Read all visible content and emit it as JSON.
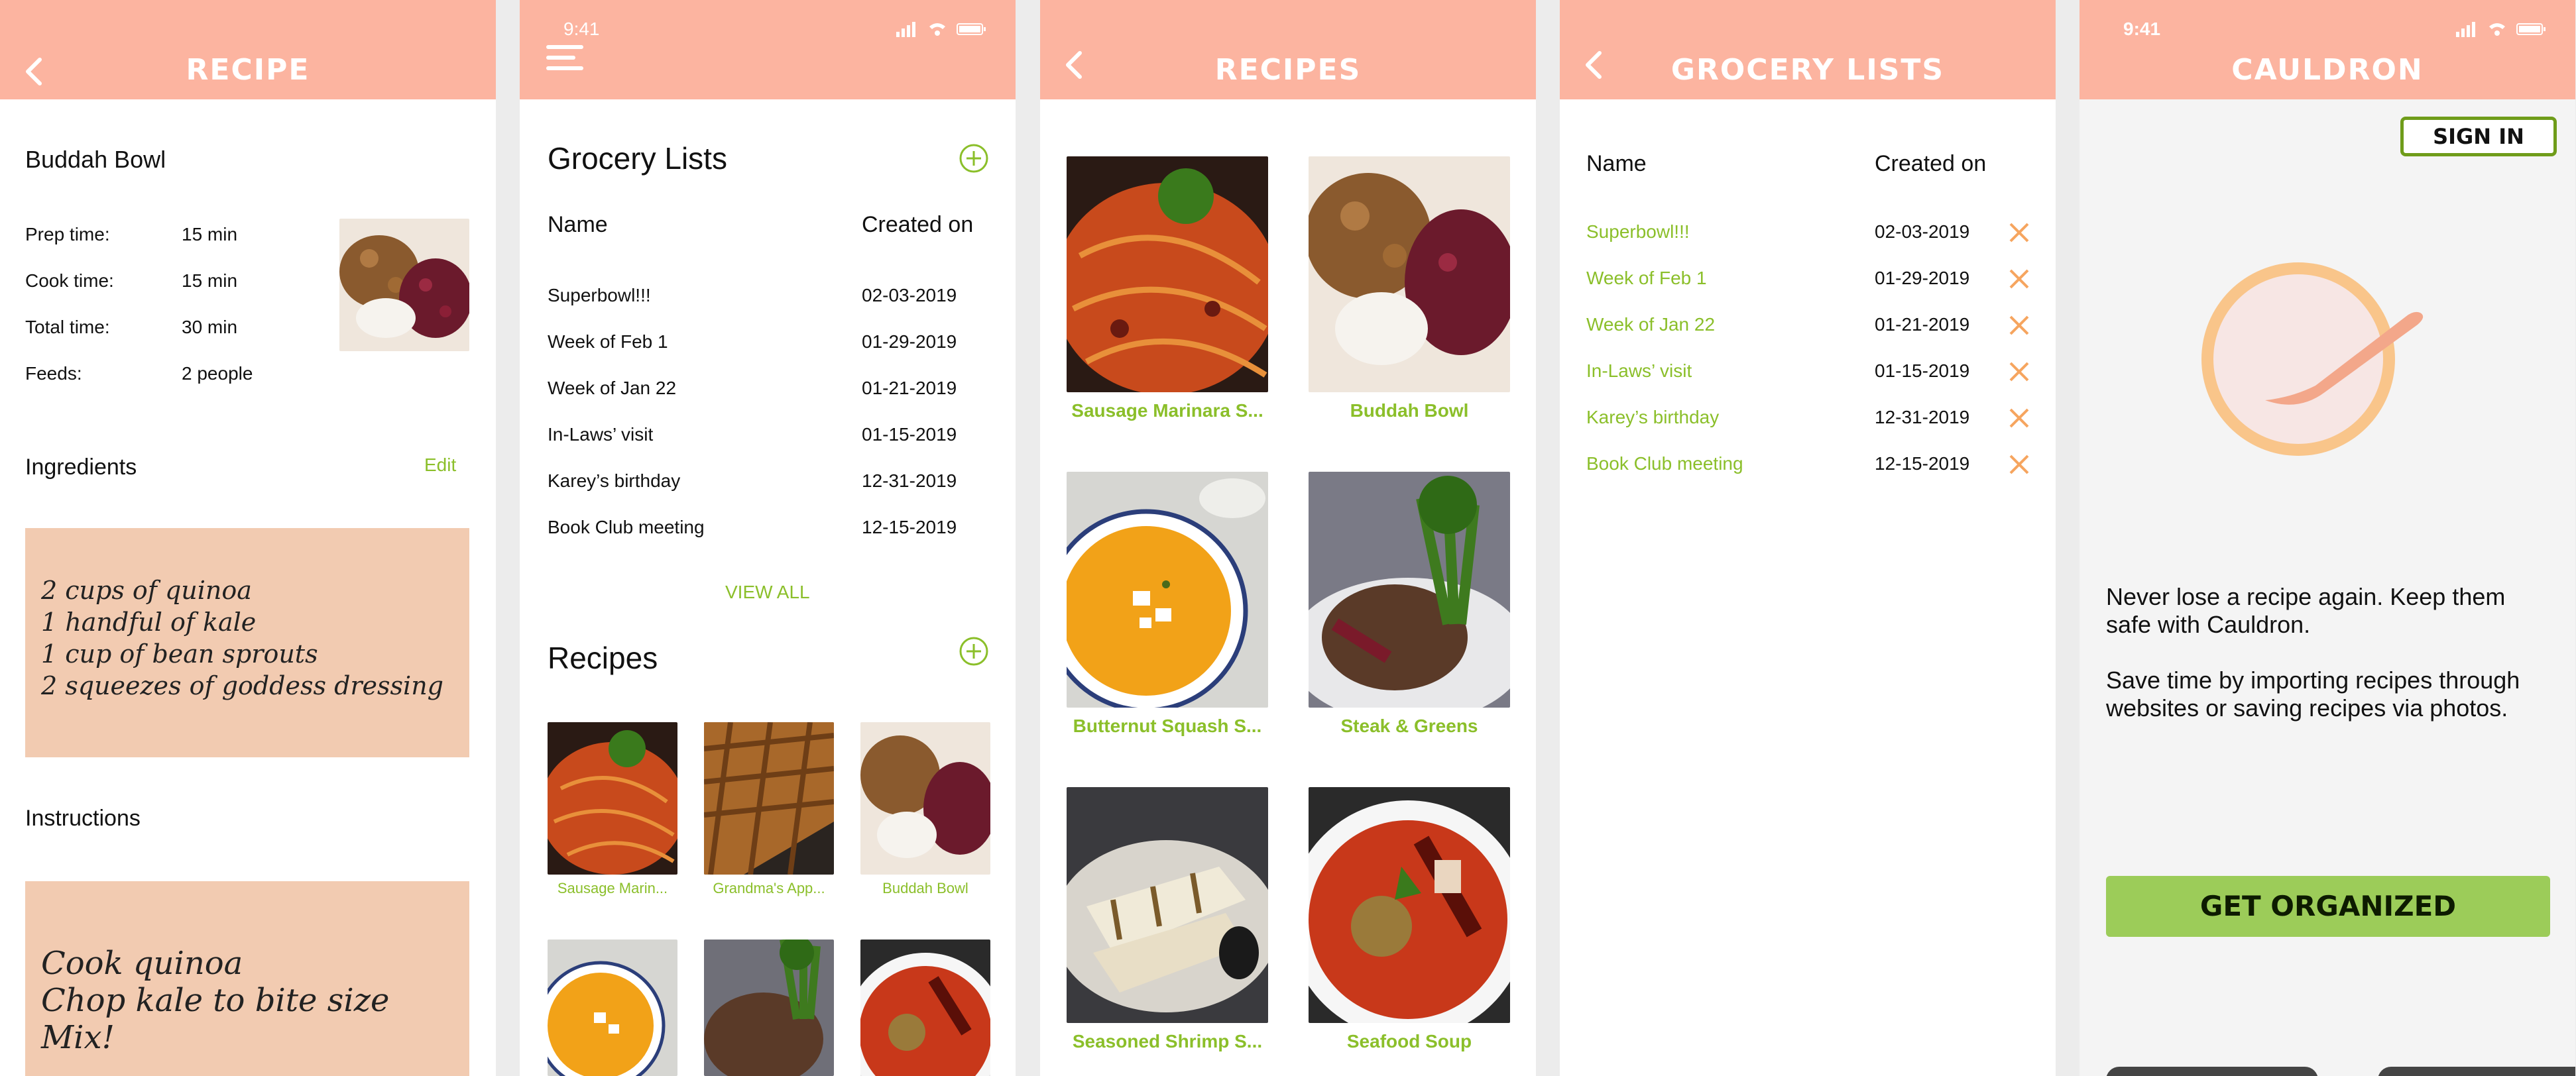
{
  "colors": {
    "header": "#fcb4a0",
    "accent_green": "#8bbf2a",
    "button_green": "#9ccc59",
    "x_orange": "#f6a55f"
  },
  "recipe_screen": {
    "header_title": "RECIPE",
    "recipe_name": "Buddah Bowl",
    "details": [
      {
        "label": "Prep time:",
        "value": "15 min"
      },
      {
        "label": "Cook time:",
        "value": "15 min"
      },
      {
        "label": "Total time:",
        "value": "30 min"
      },
      {
        "label": "Feeds:",
        "value": "2 people"
      }
    ],
    "ingredients_heading": "Ingredients",
    "edit_label": "Edit",
    "ingredients_note": [
      "2 cups of quinoa",
      "1 handful of kale",
      "1 cup of bean sprouts",
      "2 squeezes of goddess dressing"
    ],
    "instructions_heading": "Instructions",
    "instructions_note": [
      "Cook quinoa",
      "Chop kale to bite size",
      "Mix!"
    ]
  },
  "home_screen": {
    "time": "9:41",
    "grocery_heading": "Grocery Lists",
    "col_name": "Name",
    "col_created": "Created on",
    "lists": [
      {
        "name": "Superbowl!!!",
        "date": "02-03-2019"
      },
      {
        "name": "Week of Feb 1",
        "date": "01-29-2019"
      },
      {
        "name": "Week of Jan 22",
        "date": "01-21-2019"
      },
      {
        "name": "In-Laws’ visit",
        "date": "01-15-2019"
      },
      {
        "name": "Karey’s birthday",
        "date": "12-31-2019"
      },
      {
        "name": "Book Club meeting",
        "date": "12-15-2019"
      }
    ],
    "view_all": "VIEW ALL",
    "recipes_heading": "Recipes",
    "recipe_tiles": [
      {
        "label": "Sausage Marin...",
        "photo": "pasta"
      },
      {
        "label": "Grandma's App...",
        "photo": "pie"
      },
      {
        "label": "Buddah Bowl",
        "photo": "bowl"
      },
      {
        "label": "",
        "photo": "soup"
      },
      {
        "label": "",
        "photo": "steak"
      },
      {
        "label": "",
        "photo": "seafood"
      }
    ]
  },
  "recipes_screen": {
    "header_title": "RECIPES",
    "tiles": [
      {
        "label": "Sausage Marinara S...",
        "photo": "pasta"
      },
      {
        "label": "Buddah Bowl",
        "photo": "bowl"
      },
      {
        "label": "Butternut Squash S...",
        "photo": "soup"
      },
      {
        "label": "Steak & Greens",
        "photo": "steak"
      },
      {
        "label": "Seasoned Shrimp S...",
        "photo": "shrimp"
      },
      {
        "label": "Seafood Soup",
        "photo": "seafood"
      }
    ]
  },
  "grocery_screen": {
    "header_title": "GROCERY LISTS",
    "col_name": "Name",
    "col_created": "Created on",
    "lists": [
      {
        "name": "Superbowl!!!",
        "date": "02-03-2019"
      },
      {
        "name": "Week of Feb 1",
        "date": "01-29-2019"
      },
      {
        "name": "Week of Jan 22",
        "date": "01-21-2019"
      },
      {
        "name": "In-Laws’ visit",
        "date": "01-15-2019"
      },
      {
        "name": "Karey’s birthday",
        "date": "12-31-2019"
      },
      {
        "name": "Book Club meeting",
        "date": "12-15-2019"
      }
    ]
  },
  "splash_screen": {
    "time": "9:41",
    "header_title": "CAULDRON",
    "sign_in": "SIGN IN",
    "paragraph1": "Never lose a recipe again. Keep them safe with Cauldron.",
    "paragraph2": "Save time by importing recipes through websites or saving recipes via photos.",
    "cta": "GET ORGANIZED"
  }
}
